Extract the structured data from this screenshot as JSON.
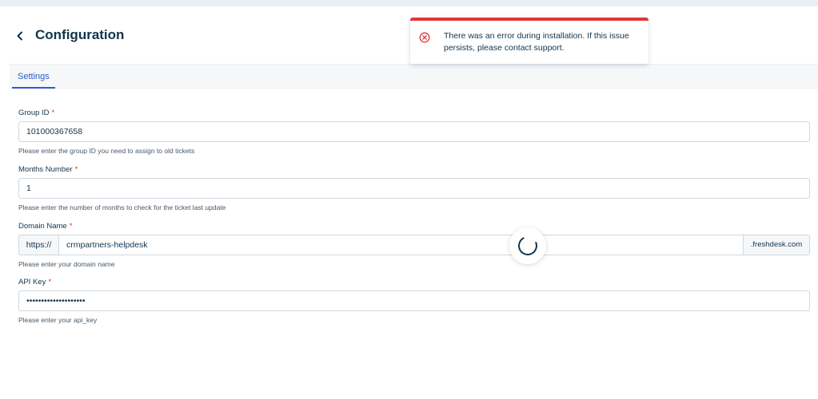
{
  "header": {
    "title": "Configuration"
  },
  "tabs": [
    {
      "label": "Settings",
      "active": true
    }
  ],
  "form": {
    "required_mark": "*",
    "group_id": {
      "label": "Group ID",
      "value": "101000367658",
      "hint": "Please enter the group ID you need to assign to old tickets"
    },
    "months_number": {
      "label": "Months Number",
      "value": "1",
      "hint": "Please enter the number of months to check for the ticket last update"
    },
    "domain_name": {
      "label": "Domain Name",
      "prefix": "https://",
      "value": "crmpartners-helpdesk",
      "suffix": ".freshdesk.com",
      "hint": "Please enter your domain name"
    },
    "api_key": {
      "label": "API Key",
      "value": "••••••••••••••••••••",
      "hint": "Please enter your api_key"
    }
  },
  "toast": {
    "type": "error",
    "icon": "error-circle-icon",
    "message": "There was an error during installation. If this issue persists, please contact support."
  },
  "colors": {
    "accent": "#2c5cc5",
    "error": "#e43538",
    "text": "#12344d"
  },
  "loading": true
}
